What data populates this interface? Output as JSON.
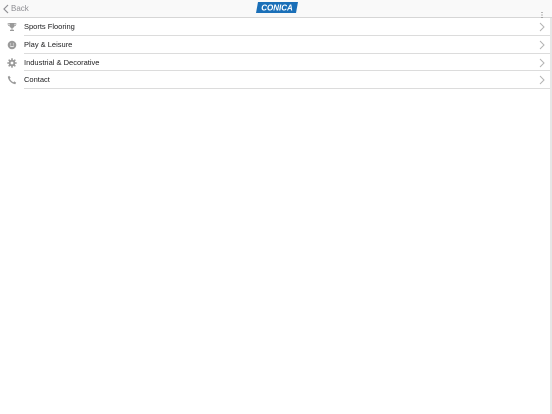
{
  "navbar": {
    "back_label": "Back",
    "logo_text": "CONICA",
    "brand_color": "#1a6fb8",
    "menu_icon": "ellipsis-vertical-icon"
  },
  "menu": {
    "items": [
      {
        "label": "Sports Flooring",
        "icon": "trophy-icon"
      },
      {
        "label": "Play & Leisure",
        "icon": "smiley-icon"
      },
      {
        "label": "Industrial & Decorative",
        "icon": "gear-icon"
      },
      {
        "label": "Contact",
        "icon": "phone-icon"
      }
    ]
  }
}
